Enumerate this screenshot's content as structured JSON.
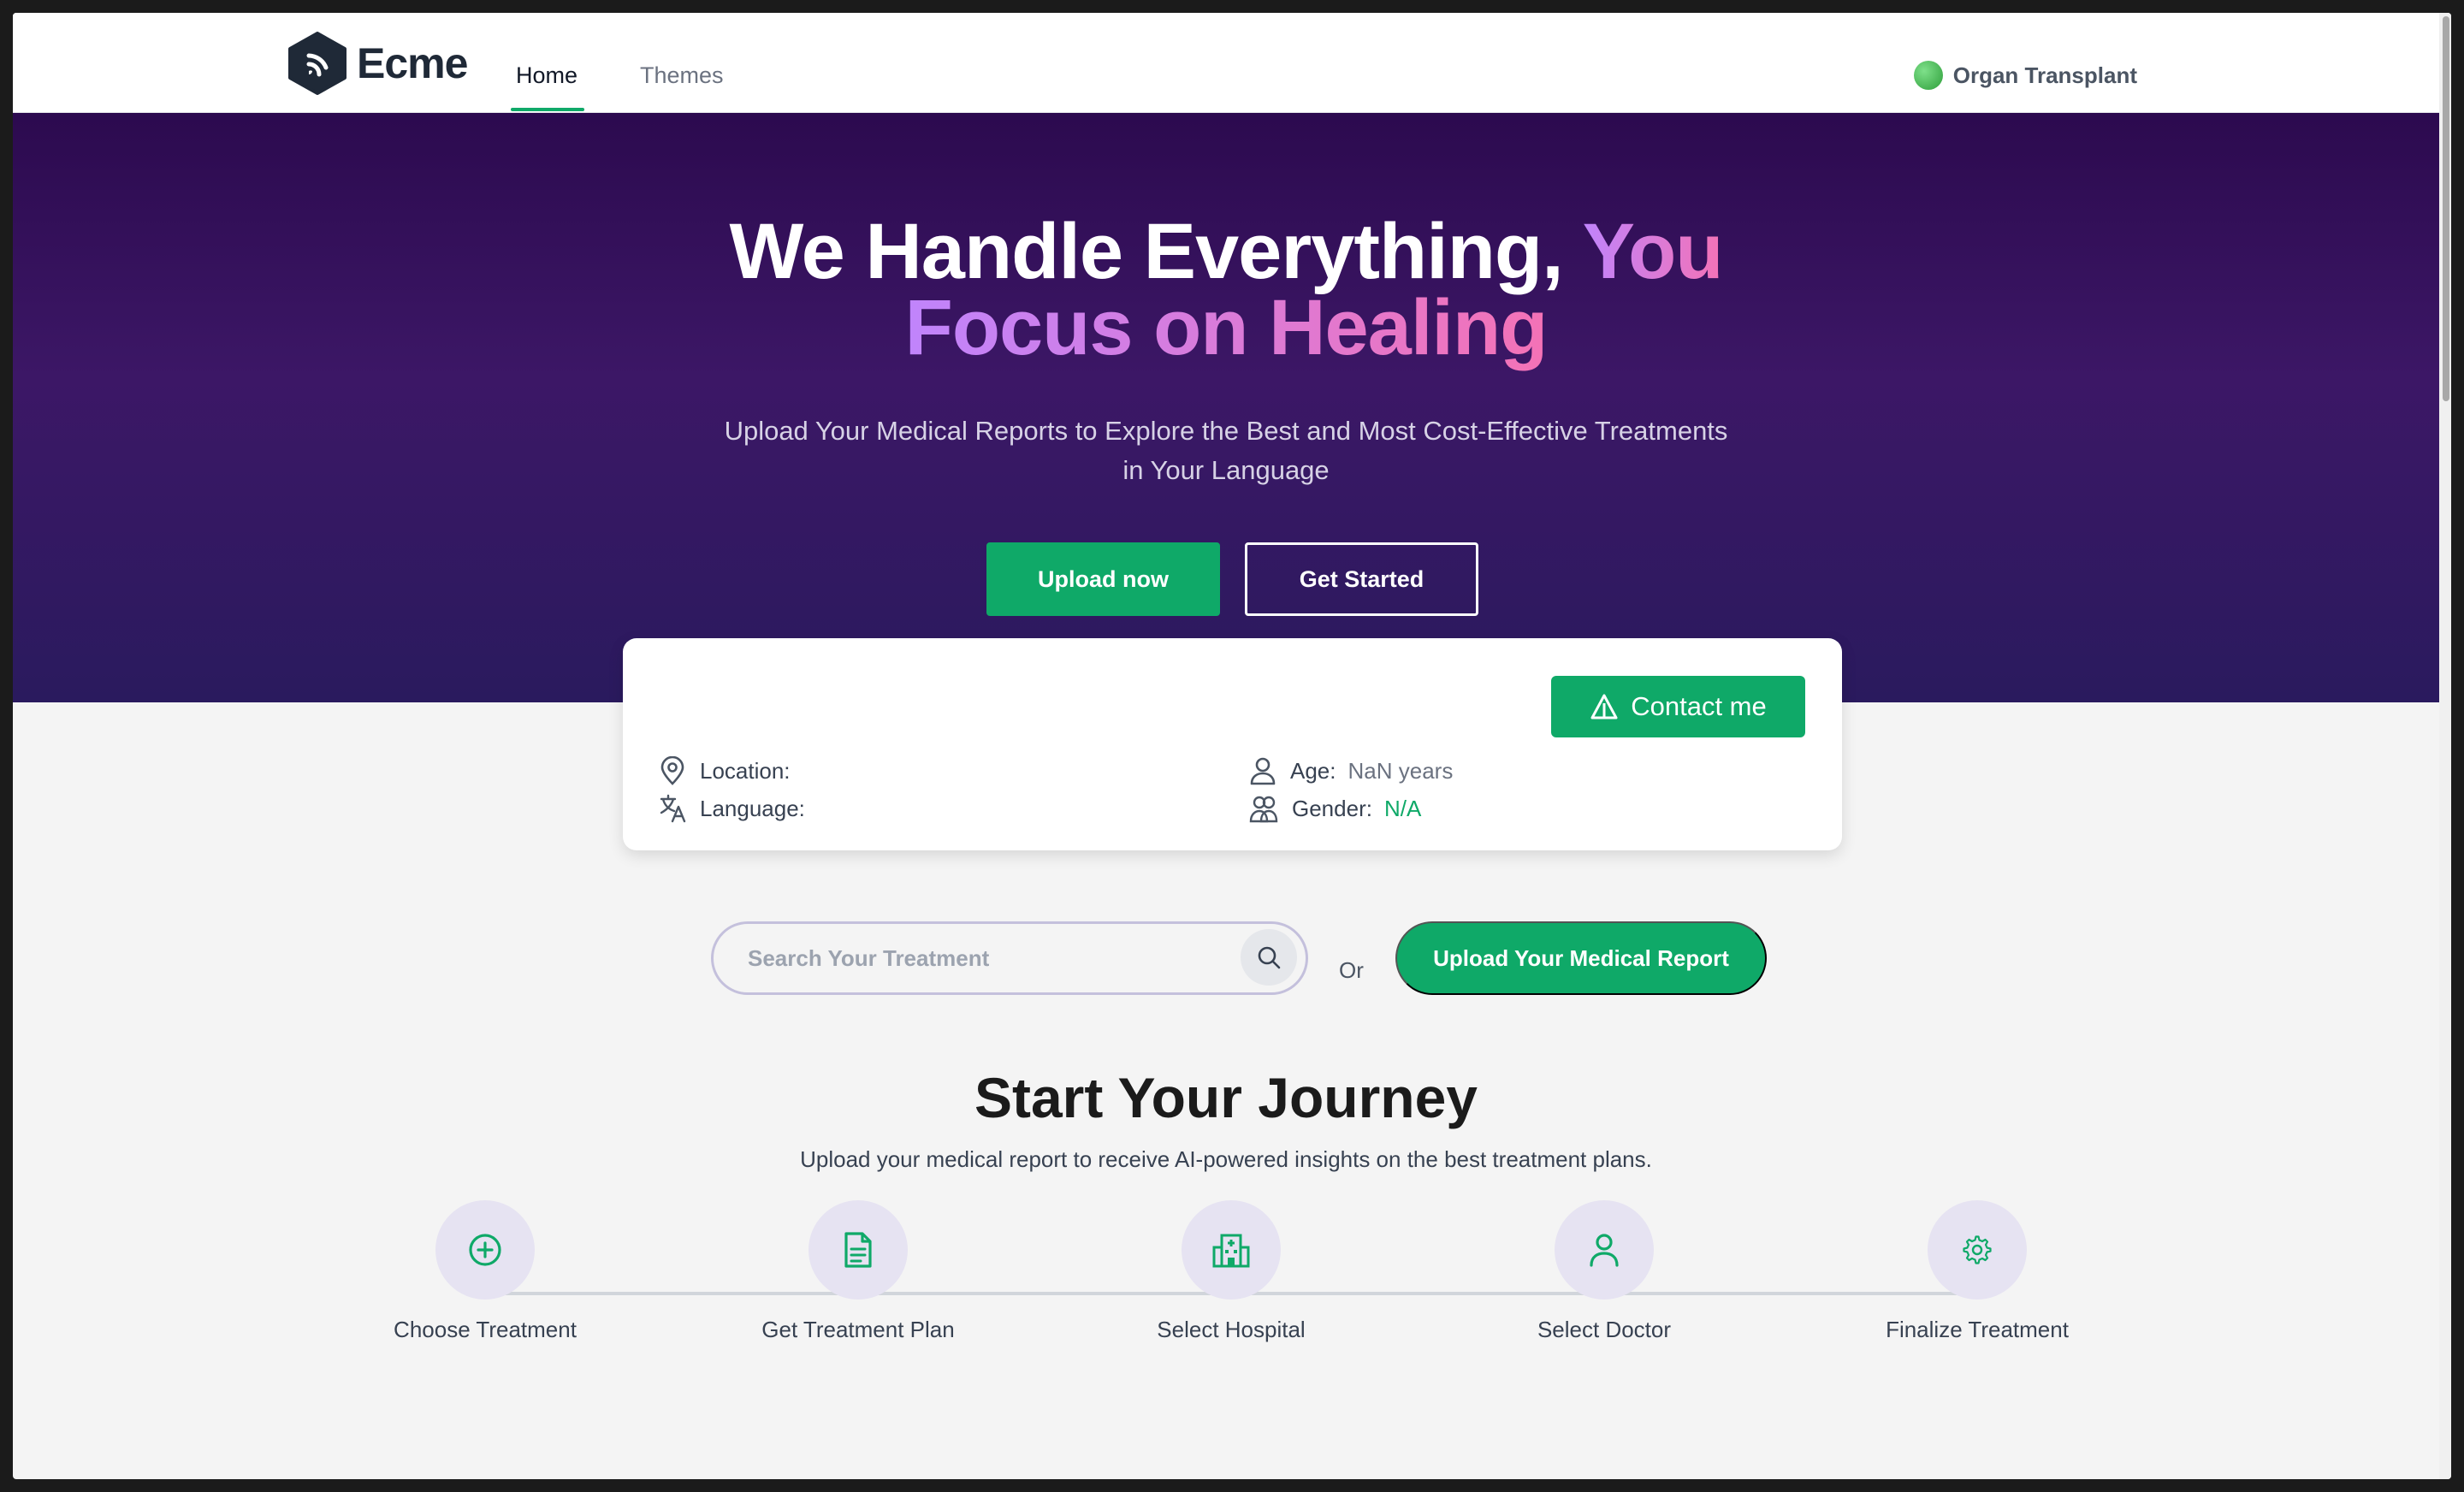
{
  "header": {
    "logo_text": "Ecme",
    "nav": [
      {
        "label": "Home",
        "active": true
      },
      {
        "label": "Themes",
        "active": false
      }
    ],
    "category_label": "Organ Transplant"
  },
  "hero": {
    "title_white": "We Handle Everything,",
    "title_gradient_1": "You",
    "title_gradient_2": "Focus on Healing",
    "subtitle_line1": "Upload Your Medical Reports to Explore the Best and Most Cost-Effective Treatments",
    "subtitle_line2": "in Your Language",
    "upload_button": "Upload now",
    "started_button": "Get Started"
  },
  "profile_card": {
    "contact_button": "Contact me",
    "location_label": "Location:",
    "location_value": "",
    "language_label": "Language:",
    "language_value": "",
    "age_label": "Age:",
    "age_value": "NaN years",
    "gender_label": "Gender:",
    "gender_value": "N/A"
  },
  "search": {
    "placeholder": "Search Your Treatment",
    "or_text": "Or",
    "upload_report_button": "Upload Your Medical Report"
  },
  "journey": {
    "title": "Start Your Journey",
    "subtitle": "Upload your medical report to receive AI-powered insights on the best treatment plans.",
    "steps": [
      {
        "label": "Choose Treatment",
        "icon": "plus-circle-icon"
      },
      {
        "label": "Get Treatment Plan",
        "icon": "document-icon"
      },
      {
        "label": "Select Hospital",
        "icon": "hospital-icon"
      },
      {
        "label": "Select Doctor",
        "icon": "user-icon"
      },
      {
        "label": "Finalize Treatment",
        "icon": "gear-icon"
      }
    ]
  },
  "colors": {
    "accent_green": "#0fa968",
    "hero_top": "#2c0a4f",
    "hero_bottom": "#2a1a5e",
    "gradient_start": "#c084fc",
    "gradient_end": "#f472b6"
  }
}
